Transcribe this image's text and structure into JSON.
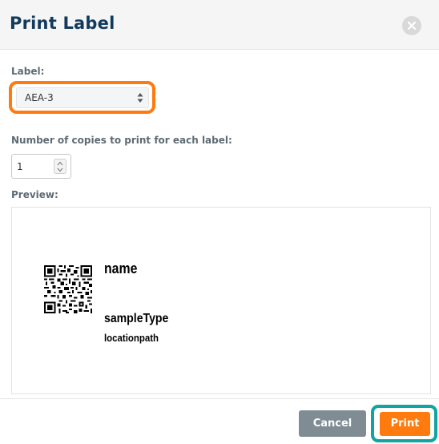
{
  "dialog": {
    "title": "Print Label",
    "close_icon": "close-icon"
  },
  "label_field": {
    "label": "Label:",
    "selected": "AEA-3",
    "highlight_color": "#ff7a0f"
  },
  "copies_field": {
    "label": "Number of copies to print for each label:",
    "value": "1"
  },
  "preview": {
    "label": "Preview:",
    "qr_icon": "qr-code-icon",
    "name": "name",
    "sample_type": "sampleType",
    "location_path": "locationpath"
  },
  "footer": {
    "cancel_label": "Cancel",
    "print_label": "Print",
    "cancel_color": "#7f8c93",
    "print_color": "#ff7a0f",
    "print_highlight_color": "#10a5a0"
  }
}
